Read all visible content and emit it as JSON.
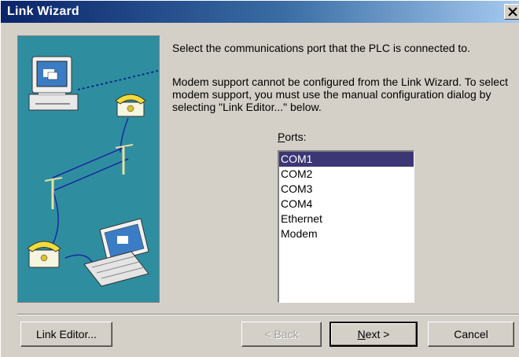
{
  "window": {
    "title": "Link Wizard",
    "close_glyph": "✕"
  },
  "content": {
    "instruction": "Select the communications port that the PLC is connected to.",
    "modem_note": "Modem support cannot be configured from the Link Wizard. To select modem support, you must use the manual configuration dialog by selecting \"Link Editor...\" below.",
    "ports_label_accel": "P",
    "ports_label_rest": "orts:"
  },
  "ports": {
    "items": [
      "COM1",
      "COM2",
      "COM3",
      "COM4",
      "Ethernet",
      "Modem"
    ],
    "selected": "COM1"
  },
  "buttons": {
    "link_editor": "Link Editor...",
    "back": "< Back",
    "next_accel": "N",
    "next_rest": "ext >",
    "cancel": "Cancel"
  },
  "icons": {
    "illustration": "plc-network-illustration",
    "close": "close-icon"
  },
  "colors": {
    "title_start": "#0a246a",
    "title_end": "#a6caf0",
    "selection": "#3b3775",
    "illustration_bg": "#2e8ea0"
  }
}
